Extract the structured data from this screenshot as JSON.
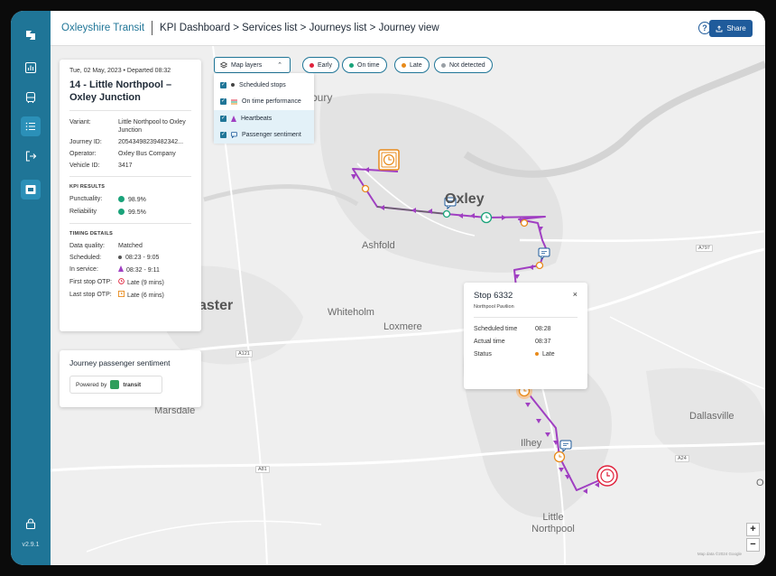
{
  "app": {
    "org_name": "Oxleyshire Transit",
    "breadcrumb": "KPI Dashboard > Services list > Journeys list > Journey view",
    "share_label": "Share",
    "help_label": "?",
    "version": "v2.9.1"
  },
  "colors": {
    "sidebar": "#1f7597",
    "primary": "#1f5b9b",
    "route": "#a03fc2",
    "early": "#e0223c",
    "on_time": "#1aa37a",
    "late": "#e88a1a",
    "not_detected": "#9aa0a6"
  },
  "sidebar": {
    "items": [
      {
        "icon": "logo-icon"
      },
      {
        "icon": "chart-icon"
      },
      {
        "icon": "bus-icon"
      },
      {
        "icon": "list-icon",
        "active": true
      },
      {
        "icon": "logout-icon"
      },
      {
        "icon": "calendar-icon"
      },
      {
        "icon": "lock-icon"
      }
    ]
  },
  "journey": {
    "date_line": "Tue, 02 May, 2023 • Departed 08:32",
    "title": "14 - Little Northpool – Oxley Junction",
    "details": [
      {
        "label": "Variant:",
        "value": "Little Northpool to Oxley Junction"
      },
      {
        "label": "Journey ID:",
        "value": "20543498239482342..."
      },
      {
        "label": "Operator:",
        "value": "Oxley Bus Company"
      },
      {
        "label": "Vehicle ID:",
        "value": "3417"
      }
    ],
    "kpi_heading": "KPI RESULTS",
    "kpis": [
      {
        "label": "Punctuality:",
        "value": "98.9%"
      },
      {
        "label": "Reliability",
        "value": "99.5%"
      }
    ],
    "timing_heading": "TIMING DETAILS",
    "timing": [
      {
        "label": "Data quality:",
        "value": "Matched"
      },
      {
        "label": "Scheduled:",
        "value": "08:23 - 9:05"
      },
      {
        "label": "In service:",
        "value": "08:32 - 9:11"
      },
      {
        "label": "First stop OTP:",
        "value": "Late (9 mins)"
      },
      {
        "label": "Last stop OTP:",
        "value": "Late (6 mins)"
      }
    ]
  },
  "sentiment": {
    "title": "Journey passenger sentiment",
    "powered_by": "Powered by",
    "brand": "transit"
  },
  "map_layers": {
    "button_label": "Map layers",
    "items": [
      {
        "label": "Scheduled stops",
        "checked": true
      },
      {
        "label": "On time performance",
        "checked": true
      },
      {
        "label": "Heartbeats",
        "checked": true
      },
      {
        "label": "Passenger sentiment",
        "checked": true
      }
    ]
  },
  "filters": [
    {
      "label": "Early",
      "color": "#e0223c"
    },
    {
      "label": "On time",
      "color": "#1aa37a"
    },
    {
      "label": "Late",
      "color": "#e88a1a"
    },
    {
      "label": "Not detected",
      "color": "#9aa0a6"
    }
  ],
  "stop_popup": {
    "title": "Stop 6332",
    "subtitle": "Northpool Pavilion",
    "close": "×",
    "rows": [
      {
        "label": "Scheduled time",
        "value": "08:28"
      },
      {
        "label": "Actual time",
        "value": "08:37"
      },
      {
        "label": "Status",
        "value": "Late",
        "color": "#e88a1a"
      }
    ]
  },
  "map": {
    "places": [
      "bury",
      "Oxley",
      "Ashfold",
      "aster",
      "Whiteholm",
      "Loxmere",
      "Marsdale",
      "Dallasville",
      "Ilhey",
      "Little Northpool",
      "O"
    ],
    "roads": [
      "A797",
      "A121",
      "A81",
      "A24"
    ],
    "zoom_in": "+",
    "zoom_out": "−",
    "attribution": "Map data ©2024 Google"
  }
}
